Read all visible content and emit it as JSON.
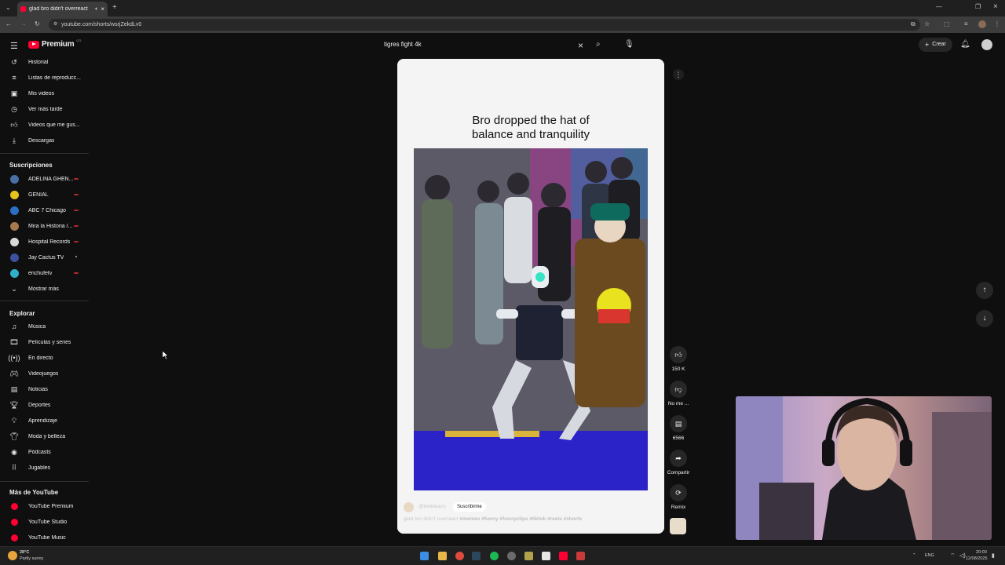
{
  "browser": {
    "tab_title": "glad bro didn't overreact",
    "url": "youtube.com/shorts/wsrjZekdLv0"
  },
  "header": {
    "logo_text": "Premium",
    "logo_badge": "CO",
    "search_value": "tigres fight  4k",
    "create_label": "Crear"
  },
  "sidebar": {
    "you_items": [
      {
        "label": "Historial",
        "icon": "history-icon"
      },
      {
        "label": "Listas de reproducc...",
        "icon": "playlist-icon"
      },
      {
        "label": "Mis videos",
        "icon": "my-videos-icon"
      },
      {
        "label": "Ver más tarde",
        "icon": "watch-later-icon"
      },
      {
        "label": "Videos que me gus...",
        "icon": "like-icon"
      },
      {
        "label": "Descargas",
        "icon": "download-icon"
      }
    ],
    "subs_title": "Suscripciones",
    "subscriptions": [
      {
        "label": "ADELINA GHEN...",
        "color": "#4a6fa5",
        "live": true
      },
      {
        "label": "GENIAL",
        "color": "#e6c21a",
        "live": true
      },
      {
        "label": "ABC 7 Chicago",
        "color": "#2b6fc4",
        "live": true
      },
      {
        "label": "Mira la Historia /...",
        "color": "#a6784c",
        "live": true
      },
      {
        "label": "Hospital Records",
        "color": "#d8d8d8",
        "live": true
      },
      {
        "label": "Jay Cactus TV",
        "color": "#3d4f9e",
        "live": false
      },
      {
        "label": "enchufetv",
        "color": "#2fb0c9",
        "live": true
      }
    ],
    "show_more": "Mostrar más",
    "explore_title": "Explorar",
    "explore": [
      {
        "label": "Música",
        "icon": "music-icon"
      },
      {
        "label": "Películas y series",
        "icon": "movies-icon"
      },
      {
        "label": "En directo",
        "icon": "live-icon"
      },
      {
        "label": "Videojuegos",
        "icon": "gaming-icon"
      },
      {
        "label": "Noticias",
        "icon": "news-icon"
      },
      {
        "label": "Deportes",
        "icon": "trophy-icon"
      },
      {
        "label": "Aprendizaje",
        "icon": "learning-icon"
      },
      {
        "label": "Moda y belleza",
        "icon": "fashion-icon"
      },
      {
        "label": "Pódcasts",
        "icon": "podcast-icon"
      },
      {
        "label": "Jugables",
        "icon": "playables-icon"
      }
    ],
    "more_title": "Más de YouTube",
    "more": [
      {
        "label": "YouTube Premium"
      },
      {
        "label": "YouTube Studio"
      },
      {
        "label": "YouTube Music"
      }
    ]
  },
  "short": {
    "caption_line1": "Bro dropped the hat of",
    "caption_line2": "balance and tranquility",
    "subscribe_label": "Suscribirme",
    "channel": "@tedeleazo",
    "description_title": "glad bro didn't overreact",
    "hashtags": "#memes #funny #funnyclips #tiktok #reels #shorts"
  },
  "actions": {
    "likes": "150 K",
    "dislike": "No me ...",
    "comments": "6566",
    "share": "Compartir",
    "remix": "Remix"
  },
  "taskbar": {
    "temp": "28°C",
    "weather": "Partly sunny",
    "lang": "ENG",
    "time": "20:00",
    "date": "12/08/2025"
  }
}
